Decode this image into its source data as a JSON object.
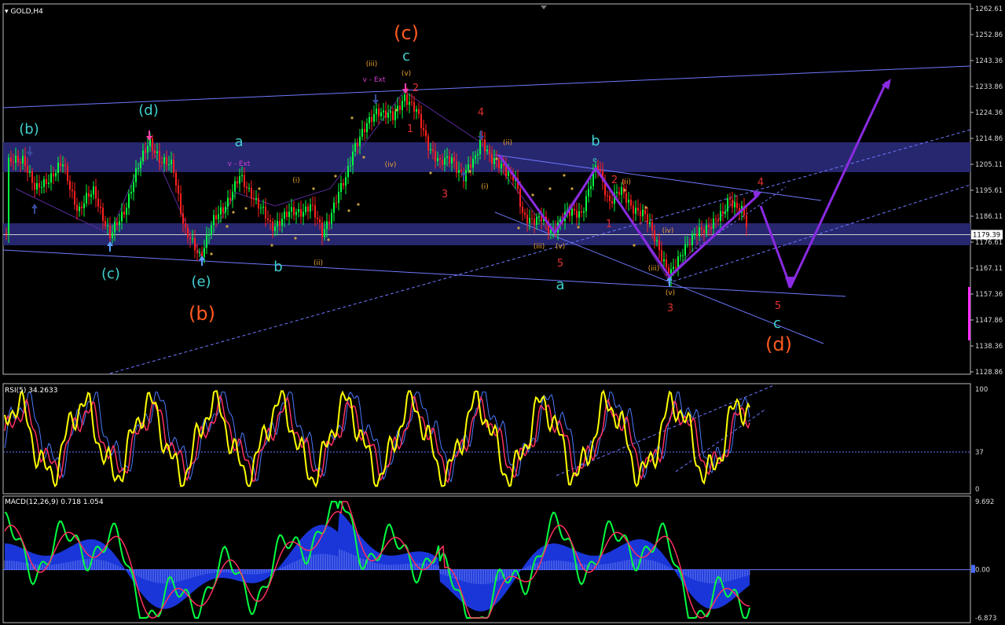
{
  "window": {
    "symbol_title": "GOLD,H4"
  },
  "colors": {
    "background": "#000000",
    "grid": "#3a3a3a",
    "bull_candle": "#00ff40",
    "bear_candle": "#ff2020",
    "zone": "#27276f",
    "trend": "#6f78ff",
    "forecast": "#8a2be2",
    "label_cyan": "#3fd0d0",
    "label_orange": "#ff5a1f",
    "label_red": "#e03030",
    "label_small": "#e8a030",
    "label_magenta": "#d040d0",
    "rsi_line": "#ffff00",
    "signal_line": "#ff3060",
    "macd_line": "#00ff40",
    "macd_hist": "#1f3fff"
  },
  "price_pane": {
    "price_axis_ticks": [
      "1262.61",
      "1252.86",
      "1243.36",
      "1233.86",
      "1224.36",
      "1214.86",
      "1205.11",
      "1195.61",
      "1186.11",
      "1176.61",
      "1167.11",
      "1157.36",
      "1147.86",
      "1138.36",
      "1128.86"
    ],
    "current_price": "1179.39"
  },
  "rsi_pane": {
    "title": "RSI(5) 34.2633",
    "axis_ticks": [
      "100",
      "37",
      "0"
    ]
  },
  "macd_pane": {
    "title": "MACD(12,26,9) 0.718 1.054",
    "axis_ticks": [
      "9.692",
      "0.00",
      "-6.873"
    ]
  },
  "wave_labels": [
    {
      "text": "(b)",
      "color": "label_cyan",
      "size": "lg"
    },
    {
      "text": "(c)",
      "color": "label_cyan",
      "size": "lg"
    },
    {
      "text": "(d)",
      "color": "label_cyan",
      "size": "lg"
    },
    {
      "text": "(e)",
      "color": "label_cyan",
      "size": "lg"
    },
    {
      "text": "(b)",
      "color": "label_orange",
      "size": "xl"
    },
    {
      "text": "a",
      "color": "label_cyan",
      "size": "lg"
    },
    {
      "text": "b",
      "color": "label_cyan",
      "size": "lg"
    },
    {
      "text": "v - Ext",
      "color": "label_magenta",
      "size": "sm"
    },
    {
      "text": "(c)",
      "color": "label_orange",
      "size": "xl"
    },
    {
      "text": "c",
      "color": "label_cyan",
      "size": "lg"
    },
    {
      "text": "(iii)",
      "color": "label_small",
      "size": "sm"
    },
    {
      "text": "v - Ext",
      "color": "label_magenta",
      "size": "sm"
    },
    {
      "text": "(v)",
      "color": "label_small",
      "size": "sm"
    },
    {
      "text": "2",
      "color": "label_red",
      "size": "md"
    },
    {
      "text": "1",
      "color": "label_red",
      "size": "md"
    },
    {
      "text": "(iv)",
      "color": "label_small",
      "size": "sm"
    },
    {
      "text": "3",
      "color": "label_red",
      "size": "md"
    },
    {
      "text": "4",
      "color": "label_red",
      "size": "md"
    },
    {
      "text": "(ii)",
      "color": "label_small",
      "size": "sm"
    },
    {
      "text": "(i)",
      "color": "label_small",
      "size": "sm"
    },
    {
      "text": "(iii)",
      "color": "label_small",
      "size": "sm"
    },
    {
      "text": "(v)",
      "color": "label_small",
      "size": "sm"
    },
    {
      "text": "5",
      "color": "label_red",
      "size": "md"
    },
    {
      "text": "a",
      "color": "label_cyan",
      "size": "lg"
    },
    {
      "text": "b",
      "color": "label_cyan",
      "size": "lg"
    },
    {
      "text": "e",
      "color": "label_cyan",
      "size": "sm"
    },
    {
      "text": "2",
      "color": "label_red",
      "size": "md"
    },
    {
      "text": "1",
      "color": "label_red",
      "size": "md"
    },
    {
      "text": "(ii)",
      "color": "label_small",
      "size": "sm"
    },
    {
      "text": "(iv)",
      "color": "label_small",
      "size": "sm"
    },
    {
      "text": "(iii)",
      "color": "label_small",
      "size": "sm"
    },
    {
      "text": "(v)",
      "color": "label_small",
      "size": "sm"
    },
    {
      "text": "3",
      "color": "label_red",
      "size": "md"
    },
    {
      "text": "4",
      "color": "label_red",
      "size": "md"
    },
    {
      "text": "5",
      "color": "label_red",
      "size": "md"
    },
    {
      "text": "c",
      "color": "label_cyan",
      "size": "lg"
    },
    {
      "text": "(d)",
      "color": "label_orange",
      "size": "xl"
    },
    {
      "text": "(i)",
      "color": "label_small",
      "size": "sm"
    },
    {
      "text": "(ii)",
      "color": "label_small",
      "size": "sm"
    }
  ]
}
